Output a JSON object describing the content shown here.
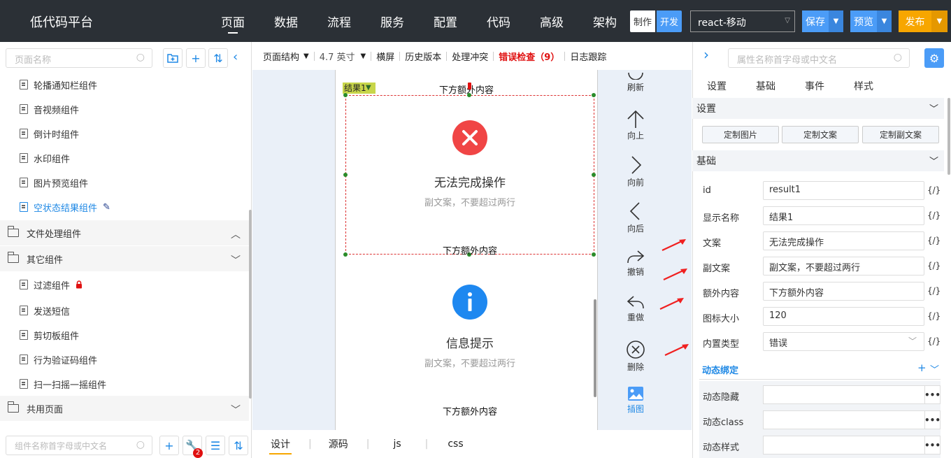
{
  "app": {
    "title": "低代码平台"
  },
  "nav": [
    "页面",
    "数据",
    "流程",
    "服务",
    "配置",
    "代码",
    "高级",
    "架构"
  ],
  "mode": {
    "make": "制作",
    "dev": "开发"
  },
  "project": {
    "selected": "react-移动"
  },
  "actions": {
    "save": "保存",
    "preview": "预览",
    "publish": "发布"
  },
  "colors": {
    "save": "#4b9cf7",
    "preview": "#4b9cf7",
    "publish": "#f7a600",
    "error_icon": "#f04545",
    "info_icon": "#1e88f0",
    "accent": "#1e88e5"
  },
  "left": {
    "page_search_placeholder": "页面名称",
    "items_top": [
      "轮播通知栏组件",
      "音视频组件",
      "倒计时组件",
      "水印组件",
      "图片预览组件",
      "空状态结果组件"
    ],
    "group_file": "文件处理组件",
    "group_other": "其它组件",
    "items_other": [
      "过滤组件",
      "发送短信",
      "剪切板组件",
      "行为验证码组件",
      "扫一扫摇一摇组件"
    ],
    "group_shared": "共用页面",
    "comp_search_placeholder": "组件名称首字母或中文名",
    "badge_count": "2"
  },
  "toolbar": {
    "structure": "页面结构",
    "size": "4.7 英寸",
    "landscape": "横屏",
    "history": "历史版本",
    "conflict": "处理冲突",
    "errors": "错误检查（9）",
    "log": "日志跟踪"
  },
  "canvas": {
    "tag": "结果1",
    "extra1": "下方额外内容",
    "title1": "无法完成操作",
    "sub1": "副文案，不要超过两行",
    "extra2": "下方额外内容",
    "title2": "信息提示",
    "sub2": "副文案，不要超过两行",
    "extra3": "下方额外内容"
  },
  "tools": [
    "刷新",
    "向上",
    "向前",
    "向后",
    "撤销",
    "重做",
    "删除",
    "插图"
  ],
  "bottom_tabs": [
    "设计",
    "源码",
    "js",
    "css"
  ],
  "right": {
    "search_placeholder": "属性名称首字母或中文名",
    "tabs": [
      "设置",
      "基础",
      "事件",
      "样式"
    ],
    "section_settings": "设置",
    "custom_buttons": [
      "定制图片",
      "定制文案",
      "定制副文案"
    ],
    "section_basic": "基础",
    "props": [
      {
        "label": "id",
        "value": "result1"
      },
      {
        "label": "显示名称",
        "value": "结果1"
      },
      {
        "label": "文案",
        "value": "无法完成操作"
      },
      {
        "label": "副文案",
        "value": "副文案，不要超过两行"
      },
      {
        "label": "额外内容",
        "value": "下方额外内容"
      },
      {
        "label": "图标大小",
        "value": "120"
      },
      {
        "label": "内置类型",
        "value": "错误"
      }
    ],
    "braces": "{/}",
    "section_dynamic": "动态绑定",
    "dynamic": [
      "动态隐藏",
      "动态class",
      "动态样式"
    ]
  }
}
